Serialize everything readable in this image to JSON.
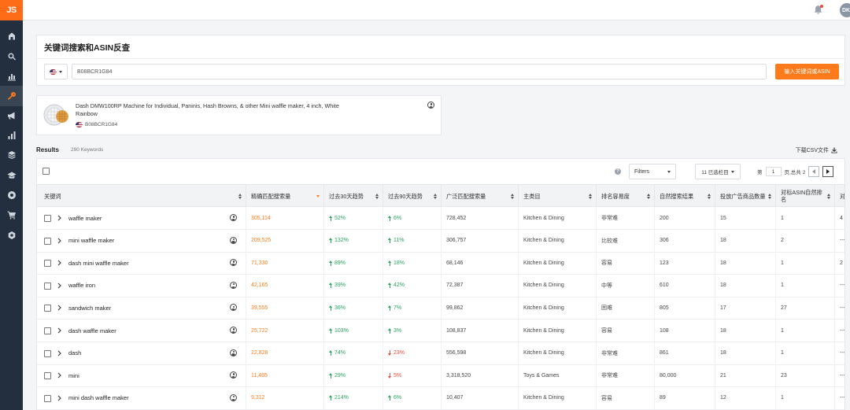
{
  "app": {
    "logo": "JS",
    "avatar_initials": "DK"
  },
  "colors": {
    "accent": "#ff7a1a",
    "sidebar": "#232f3e",
    "up": "#27a35c",
    "down": "#e74c3c"
  },
  "sidebar": {
    "items": [
      {
        "icon": "dashboard-icon"
      },
      {
        "icon": "search-icon"
      },
      {
        "icon": "chart-icon"
      },
      {
        "icon": "key-icon",
        "active": true
      },
      {
        "icon": "megaphone-icon"
      },
      {
        "icon": "bar-chart-icon"
      },
      {
        "icon": "stack-icon"
      },
      {
        "icon": "graduation-cap-icon"
      },
      {
        "icon": "chrome-icon"
      },
      {
        "icon": "cart-icon"
      },
      {
        "icon": "settings-icon"
      }
    ]
  },
  "search": {
    "title": "关键词搜索和ASIN反查",
    "value": "B08BCR1G84",
    "button_label": "输入关键词或ASIN"
  },
  "product": {
    "title": "Dash DMW100RP Machine for Individual, Paninis, Hash Browns, & other Mini waffle maker, 4 inch, White Rainbow",
    "asin": "B08BCR1G84"
  },
  "results": {
    "label": "Results",
    "count": "290 Keywords",
    "csv_label": "下载CSV文件"
  },
  "toolbar": {
    "help": "?",
    "filters_label": "Filters",
    "columns_label": "11 已选栏目",
    "page_prefix": "第",
    "page_value": "1",
    "page_suffix": "页,总共 2"
  },
  "columns": [
    "关键词",
    "精确匹配搜索量",
    "过去30天趋势",
    "过去90天趋势",
    "广泛匹配搜索量",
    "主类目",
    "排名容易度",
    "自然搜索结果",
    "投放广告商品数量",
    "对标ASIN自然排名",
    "对"
  ],
  "rows": [
    {
      "keyword": "waffle maker",
      "exact": "305,114",
      "t30": "52%",
      "t30_dir": "up",
      "t90": "6%",
      "t90_dir": "up",
      "broad": "728,452",
      "category": "Kitchen & Dining",
      "ease": "非常难",
      "organic": "200",
      "sponsored": "15",
      "asin_rank": "1",
      "extra": "4"
    },
    {
      "keyword": "mini waffle maker",
      "exact": "209,525",
      "t30": "132%",
      "t30_dir": "up",
      "t90": "11%",
      "t90_dir": "up",
      "broad": "306,757",
      "category": "Kitchen & Dining",
      "ease": "比较难",
      "organic": "306",
      "sponsored": "18",
      "asin_rank": "2",
      "extra": "---"
    },
    {
      "keyword": "dash mini waffle maker",
      "exact": "71,330",
      "t30": "89%",
      "t30_dir": "up",
      "t90": "18%",
      "t90_dir": "up",
      "broad": "68,146",
      "category": "Kitchen & Dining",
      "ease": "容易",
      "organic": "123",
      "sponsored": "18",
      "asin_rank": "1",
      "extra": "2"
    },
    {
      "keyword": "waffle iron",
      "exact": "42,165",
      "t30": "39%",
      "t30_dir": "up",
      "t90": "42%",
      "t90_dir": "up",
      "broad": "72,387",
      "category": "Kitchen & Dining",
      "ease": "中等",
      "organic": "610",
      "sponsored": "18",
      "asin_rank": "1",
      "extra": "---"
    },
    {
      "keyword": "sandwich maker",
      "exact": "39,555",
      "t30": "36%",
      "t30_dir": "up",
      "t90": "7%",
      "t90_dir": "up",
      "broad": "99,862",
      "category": "Kitchen & Dining",
      "ease": "困难",
      "organic": "805",
      "sponsored": "17",
      "asin_rank": "27",
      "extra": "---"
    },
    {
      "keyword": "dash waffle maker",
      "exact": "25,722",
      "t30": "103%",
      "t30_dir": "up",
      "t90": "3%",
      "t90_dir": "up",
      "broad": "108,837",
      "category": "Kitchen & Dining",
      "ease": "容易",
      "organic": "108",
      "sponsored": "18",
      "asin_rank": "1",
      "extra": "---"
    },
    {
      "keyword": "dash",
      "exact": "22,828",
      "t30": "74%",
      "t30_dir": "up",
      "t90": "23%",
      "t90_dir": "down",
      "broad": "556,598",
      "category": "Kitchen & Dining",
      "ease": "非常难",
      "organic": "861",
      "sponsored": "18",
      "asin_rank": "1",
      "extra": "---"
    },
    {
      "keyword": "mini",
      "exact": "11,465",
      "t30": "29%",
      "t30_dir": "up",
      "t90": "5%",
      "t90_dir": "down",
      "broad": "3,318,520",
      "category": "Toys & Games",
      "ease": "非常难",
      "organic": "80,000",
      "sponsored": "21",
      "asin_rank": "23",
      "extra": "---"
    },
    {
      "keyword": "mini dash waffle maker",
      "exact": "9,312",
      "t30": "214%",
      "t30_dir": "up",
      "t90": "6%",
      "t90_dir": "up",
      "broad": "10,407",
      "category": "Kitchen & Dining",
      "ease": "容易",
      "organic": "89",
      "sponsored": "12",
      "asin_rank": "1",
      "extra": "---"
    }
  ]
}
